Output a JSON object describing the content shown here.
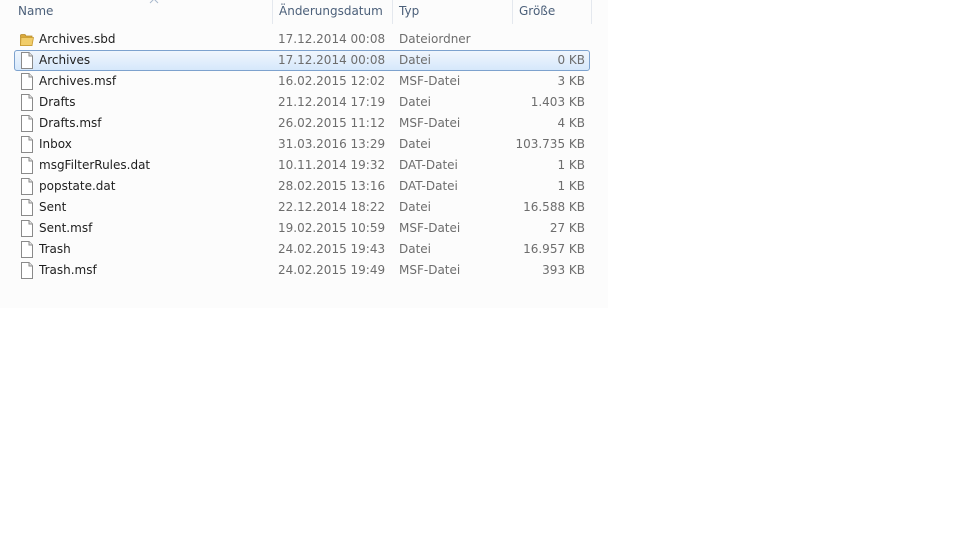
{
  "columns": {
    "name": "Name",
    "date": "Änderungsdatum",
    "type": "Typ",
    "size": "Größe"
  },
  "rows": [
    {
      "name": "Archives.sbd",
      "date": "17.12.2014 00:08",
      "type": "Dateiordner",
      "size": "",
      "icon": "folder-icon",
      "selected": false
    },
    {
      "name": "Archives",
      "date": "17.12.2014 00:08",
      "type": "Datei",
      "size": "0 KB",
      "icon": "file-icon",
      "selected": true
    },
    {
      "name": "Archives.msf",
      "date": "16.02.2015 12:02",
      "type": "MSF-Datei",
      "size": "3 KB",
      "icon": "file-icon",
      "selected": false
    },
    {
      "name": "Drafts",
      "date": "21.12.2014 17:19",
      "type": "Datei",
      "size": "1.403 KB",
      "icon": "file-icon",
      "selected": false
    },
    {
      "name": "Drafts.msf",
      "date": "26.02.2015 11:12",
      "type": "MSF-Datei",
      "size": "4 KB",
      "icon": "file-icon",
      "selected": false
    },
    {
      "name": "Inbox",
      "date": "31.03.2016 13:29",
      "type": "Datei",
      "size": "103.735 KB",
      "icon": "file-icon",
      "selected": false
    },
    {
      "name": "msgFilterRules.dat",
      "date": "10.11.2014 19:32",
      "type": "DAT-Datei",
      "size": "1 KB",
      "icon": "file-icon",
      "selected": false
    },
    {
      "name": "popstate.dat",
      "date": "28.02.2015 13:16",
      "type": "DAT-Datei",
      "size": "1 KB",
      "icon": "file-icon",
      "selected": false
    },
    {
      "name": "Sent",
      "date": "22.12.2014 18:22",
      "type": "Datei",
      "size": "16.588 KB",
      "icon": "file-icon",
      "selected": false
    },
    {
      "name": "Sent.msf",
      "date": "19.02.2015 10:59",
      "type": "MSF-Datei",
      "size": "27 KB",
      "icon": "file-icon",
      "selected": false
    },
    {
      "name": "Trash",
      "date": "24.02.2015 19:43",
      "type": "Datei",
      "size": "16.957 KB",
      "icon": "file-icon",
      "selected": false
    },
    {
      "name": "Trash.msf",
      "date": "24.02.2015 19:49",
      "type": "MSF-Datei",
      "size": "393 KB",
      "icon": "file-icon",
      "selected": false
    }
  ],
  "colors": {
    "header_text": "#4c607a",
    "selection_border": "#7da2ce",
    "folder": "#e8c35c"
  }
}
